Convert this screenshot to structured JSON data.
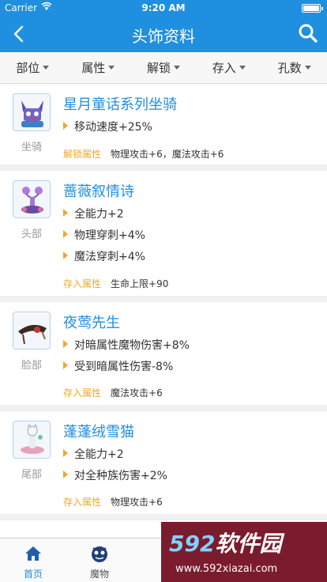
{
  "status_bar": {
    "carrier": "Carrier",
    "time": "9:20 AM"
  },
  "nav": {
    "title": "头饰资料",
    "back_icon": "chevron-left-icon",
    "search_icon": "search-icon"
  },
  "filters": [
    {
      "label": "部位"
    },
    {
      "label": "属性"
    },
    {
      "label": "解锁"
    },
    {
      "label": "存入"
    },
    {
      "label": "孔数"
    }
  ],
  "items": [
    {
      "name": "星月童话系列坐骑",
      "slot": "坐骑",
      "effects": [
        "移动速度+25%"
      ],
      "extra_label": "解锁属性",
      "extra_value": "物理攻击+6，魔法攻击+6"
    },
    {
      "name": "蔷薇叙情诗",
      "slot": "头部",
      "effects": [
        "全能力+2",
        "物理穿刺+4%",
        "魔法穿刺+4%"
      ],
      "extra_label": "存入属性",
      "extra_value": "生命上限+90"
    },
    {
      "name": "夜莺先生",
      "slot": "脸部",
      "effects": [
        "对暗属性魔物伤害+8%",
        "受到暗属性伤害-8%"
      ],
      "extra_label": "存入属性",
      "extra_value": "魔法攻击+6"
    },
    {
      "name": "蓬蓬绒雪猫",
      "slot": "尾部",
      "effects": [
        "全能力+2",
        "对全种族伤害+2%"
      ],
      "extra_label": "存入属性",
      "extra_value": "物理攻击+6"
    }
  ],
  "tabs": [
    {
      "label": "首页",
      "icon": "home-icon",
      "active": true
    },
    {
      "label": "魔物",
      "icon": "monster-icon",
      "active": false
    }
  ],
  "watermark": {
    "brand_num": "592",
    "brand_text": "软件园",
    "url": "www.592xiazai.com"
  },
  "colors": {
    "primary": "#1f8fe0",
    "accent": "#f2a72c"
  }
}
